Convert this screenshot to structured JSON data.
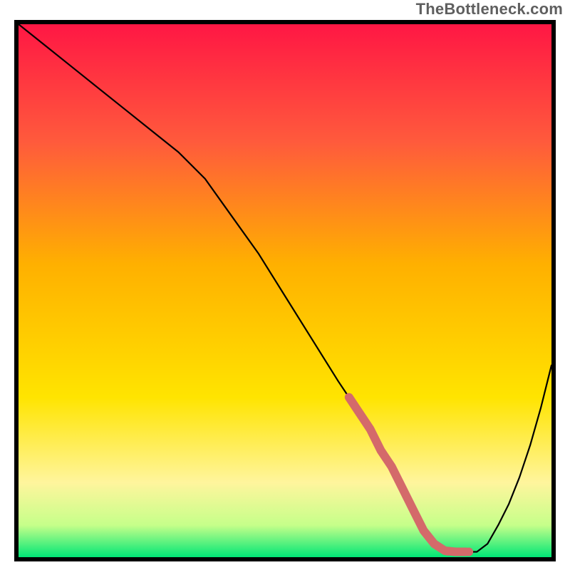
{
  "watermark": "TheBottleneck.com",
  "colors": {
    "gradient": [
      "#ff1744",
      "#ff5a3c",
      "#ffb000",
      "#ffe400",
      "#fff59d",
      "#c6ff8a",
      "#00e676"
    ],
    "curve": "#000000",
    "marker": "#d46a6a"
  },
  "chart_data": {
    "type": "line",
    "title": "",
    "xlabel": "",
    "ylabel": "",
    "xlim": [
      0,
      100
    ],
    "ylim": [
      0,
      100
    ],
    "x": [
      0,
      5,
      10,
      15,
      20,
      25,
      30,
      35,
      40,
      45,
      50,
      55,
      60,
      62,
      64,
      66,
      68,
      70,
      72,
      74,
      76,
      78,
      80,
      82,
      84,
      86,
      88,
      90,
      92,
      94,
      96,
      98,
      100
    ],
    "y": [
      100,
      96,
      92,
      88,
      84,
      80,
      76,
      71,
      64,
      57,
      49,
      41,
      33,
      30,
      27,
      24,
      20,
      17,
      13,
      9,
      5,
      2.5,
      1.2,
      1.0,
      1.0,
      1.0,
      2.5,
      6,
      10,
      15,
      21,
      28,
      36
    ],
    "highlight_segment": {
      "x": [
        62,
        64,
        66,
        68,
        70,
        72,
        74,
        76,
        78,
        80,
        82,
        84
      ],
      "y": [
        30,
        27,
        24,
        20,
        17,
        13,
        9,
        5,
        2.5,
        1.2,
        1.0,
        1.0
      ]
    },
    "highlight_dots": {
      "x": [
        80.5,
        82.5,
        84.5
      ],
      "y": [
        1.1,
        1.0,
        1.0
      ]
    }
  }
}
